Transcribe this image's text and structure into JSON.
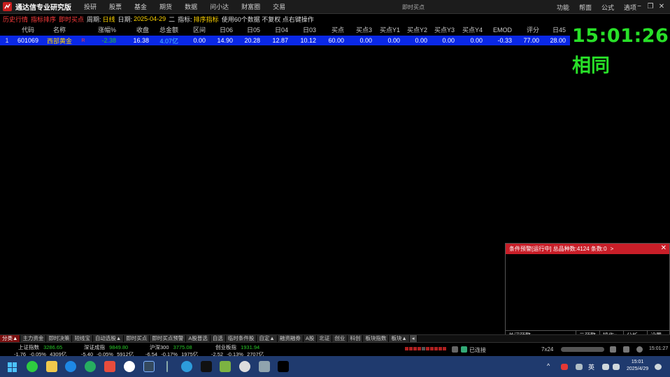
{
  "titlebar": {
    "app_title": "通达信专业研究版",
    "menu": [
      "投研",
      "股票",
      "基金",
      "期货",
      "数据",
      "问小达",
      "财富圈",
      "交易"
    ],
    "center_title": "即时买点",
    "right_menu": [
      "功能",
      "帮面",
      "公式",
      "选项"
    ],
    "window_controls": [
      "←",
      "−",
      "❐",
      "✕"
    ]
  },
  "infobar": {
    "history": "历史行情",
    "indicator_sort": "指标排序",
    "instant_buy": "即时买点",
    "period_label": "周期:",
    "period_value": "日线",
    "date_label": "日期:",
    "date_value": "2025-04-29",
    "weekday": "二",
    "indicator_label": "指标:",
    "indicator_value": "排序指标",
    "note": "使用60个数据 不复权 点右键操作"
  },
  "table": {
    "columns": [
      "代码",
      "名称",
      "",
      "涨幅%",
      "收盘",
      "总金额",
      "区间",
      "日06",
      "日05",
      "日04",
      "日03",
      "买点",
      "买点3",
      "买点Y1",
      "买点Y2",
      "买点Y3",
      "买点Y4",
      "EMOD",
      "评分",
      "日45"
    ],
    "rows": [
      {
        "idx": "1",
        "code": "601069",
        "name": "西部黄金",
        "flag": "R",
        "pct": "-2.38",
        "close": "16.38",
        "amount": "4.07亿",
        "range": "0.00",
        "d06": "14.90",
        "d05": "20.28",
        "d04": "12.87",
        "d03": "10.12",
        "buy": "60.00",
        "buy3": "0.00",
        "buyY1": "0.00",
        "buyY2": "0.00",
        "buyY3": "0.00",
        "buyY4": "0.00",
        "emod": "-0.33",
        "score": "77.00",
        "d45": "28.00"
      }
    ]
  },
  "clock": {
    "time": "15:01:26",
    "status": "相同"
  },
  "alert_panel": {
    "title": "条件预警[运行中] 总品种数:4124 条数:0",
    "more": ">",
    "footer_label": "关闭预警",
    "buttons": [
      "云预警",
      "操作▾",
      "分析",
      "设置"
    ]
  },
  "tabs": [
    "分类▲",
    "主力资金",
    "即时决策",
    "短线宝",
    "自动选股▲",
    "即时买点",
    "即时买点预警",
    "A股普选",
    "自选",
    "临时条件股",
    "自定▲",
    "融资融券",
    "A股",
    "北证",
    "创业",
    "科创",
    "板块指数",
    "板块▲"
  ],
  "indices": [
    {
      "name": "上证指数",
      "value": "3286.65",
      "chg": "-1.76",
      "pct": "-0.05%",
      "amount": "4309亿"
    },
    {
      "name": "深证成指",
      "value": "9849.80",
      "chg": "-5.40",
      "pct": "-0.05%",
      "amount": "5912亿"
    },
    {
      "name": "沪深300",
      "value": "3775.08",
      "chg": "-6.54",
      "pct": "-0.17%",
      "amount": "1975亿"
    },
    {
      "name": "创业板指",
      "value": "1931.94",
      "chg": "-2.52",
      "pct": "-0.13%",
      "amount": "2707亿"
    }
  ],
  "status": {
    "connection": "已连接",
    "grid": "7x24",
    "time": "15:01:27"
  },
  "taskbar": {
    "lang": "英",
    "clock_time": "15:01",
    "clock_date": "2025/4/29"
  },
  "colors": {
    "selected_row": "#0a28e6",
    "up": "#ff3c3c",
    "down": "#28c828",
    "clock": "#28e028",
    "alert_head": "#c81e28"
  }
}
